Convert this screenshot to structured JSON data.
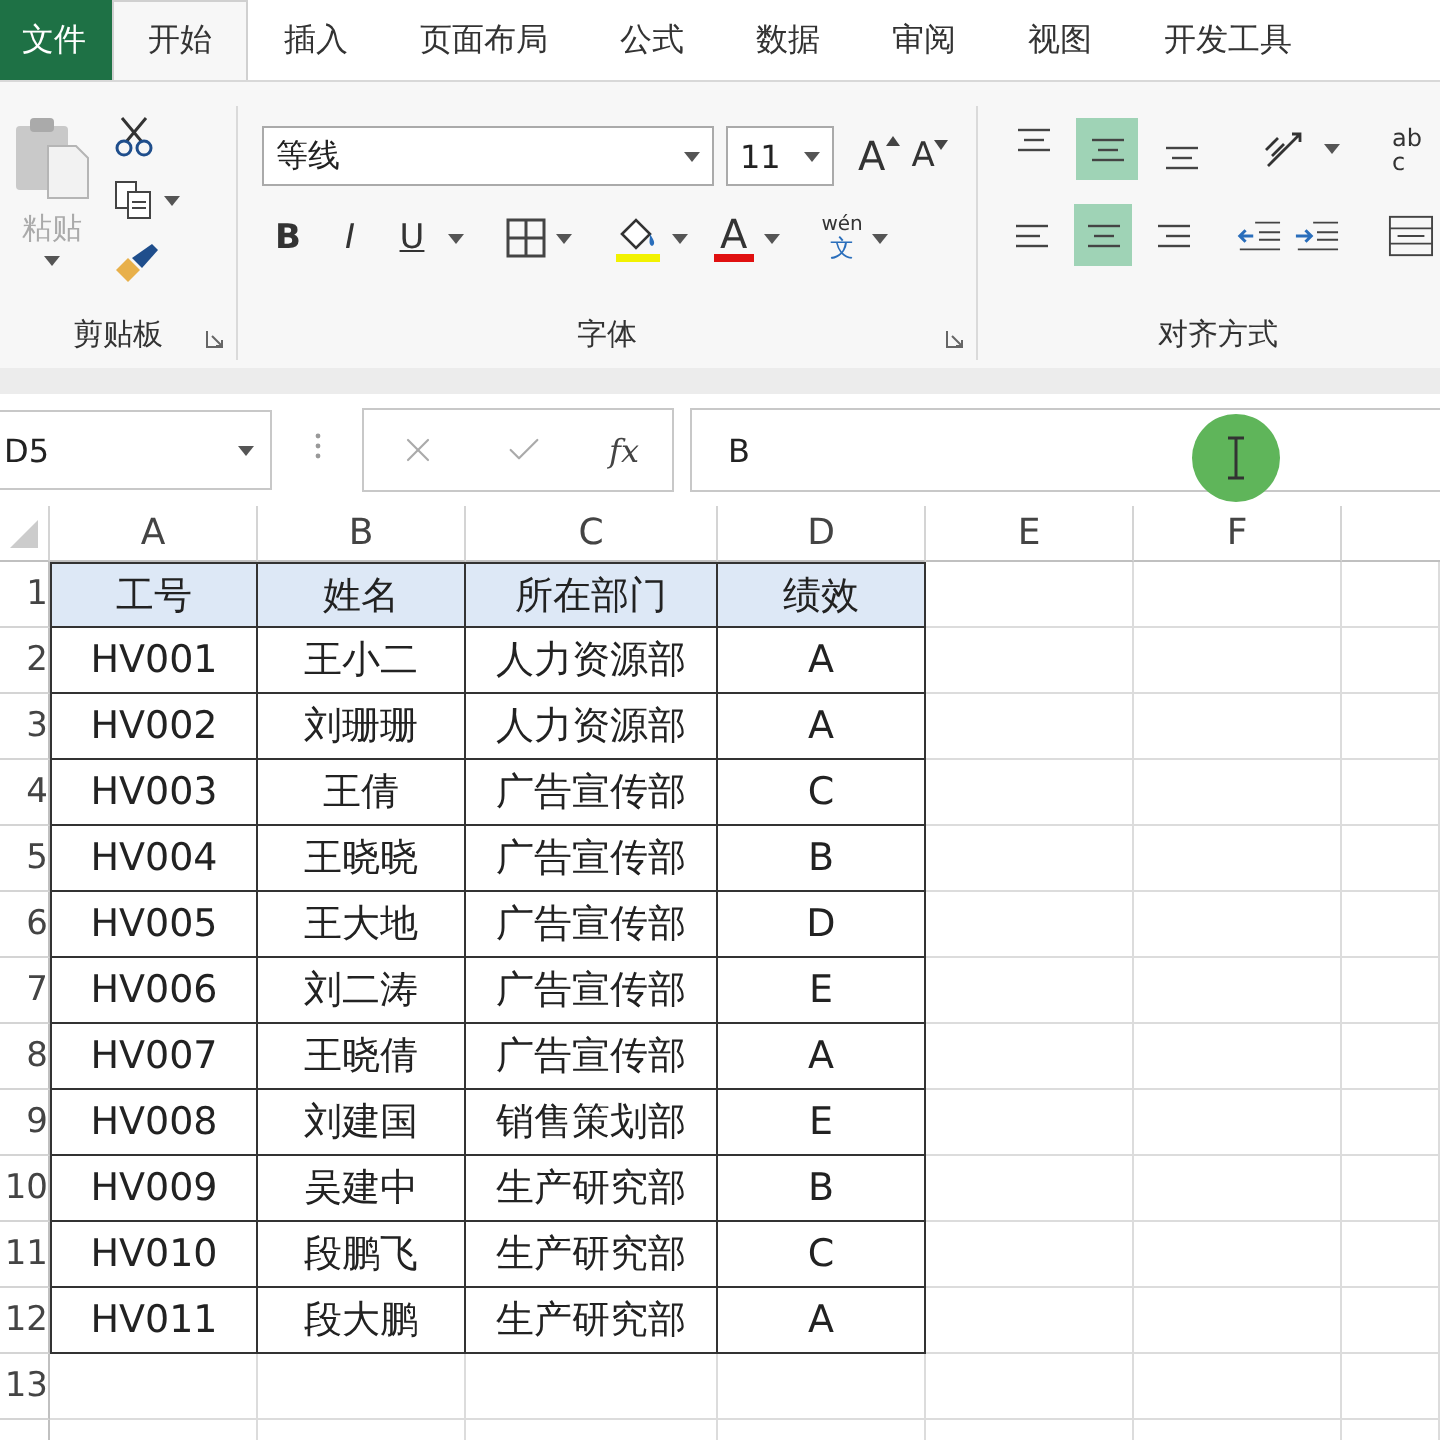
{
  "tabs": [
    {
      "label": "文件",
      "kind": "file",
      "selected": false
    },
    {
      "label": "开始",
      "kind": "tab",
      "selected": true
    },
    {
      "label": "插入",
      "kind": "tab",
      "selected": false
    },
    {
      "label": "页面布局",
      "kind": "tab",
      "selected": false
    },
    {
      "label": "公式",
      "kind": "tab",
      "selected": false
    },
    {
      "label": "数据",
      "kind": "tab",
      "selected": false
    },
    {
      "label": "审阅",
      "kind": "tab",
      "selected": false
    },
    {
      "label": "视图",
      "kind": "tab",
      "selected": false
    },
    {
      "label": "开发工具",
      "kind": "tab",
      "selected": false
    }
  ],
  "clipboard": {
    "paste_label": "粘贴",
    "group_label": "剪贴板"
  },
  "font": {
    "font_name": "等线",
    "font_size": "11",
    "grow": "A",
    "shrink": "A",
    "styles": [
      "B",
      "I",
      "U"
    ],
    "font_color": "A",
    "phonetic_top": "wén",
    "phonetic_bottom": "文",
    "group_label": "字体"
  },
  "alignment": {
    "vertical": [
      {
        "selected": false
      },
      {
        "selected": true
      },
      {
        "selected": false
      }
    ],
    "horizontal": [
      {
        "selected": false
      },
      {
        "selected": true
      },
      {
        "selected": false
      }
    ],
    "wrap_top": "ab",
    "wrap_bottom": "c",
    "group_label": "对齐方式"
  },
  "formula_bar": {
    "name_box": "D5",
    "fx": "fx",
    "value": "B"
  },
  "columns": [
    "A",
    "B",
    "C",
    "D",
    "E",
    "F"
  ],
  "rows": [
    {
      "number": "1",
      "kind": "header",
      "cells": [
        "工号",
        "姓名",
        "所在部门",
        "绩效"
      ]
    },
    {
      "number": "2",
      "kind": "data",
      "cells": [
        "HV001",
        "王小二",
        "人力资源部",
        "A"
      ]
    },
    {
      "number": "3",
      "kind": "data",
      "cells": [
        "HV002",
        "刘珊珊",
        "人力资源部",
        "A"
      ]
    },
    {
      "number": "4",
      "kind": "data",
      "cells": [
        "HV003",
        "王倩",
        "广告宣传部",
        "C"
      ]
    },
    {
      "number": "5",
      "kind": "data",
      "cells": [
        "HV004",
        "王晓晓",
        "广告宣传部",
        "B"
      ]
    },
    {
      "number": "6",
      "kind": "data",
      "cells": [
        "HV005",
        "王大地",
        "广告宣传部",
        "D"
      ]
    },
    {
      "number": "7",
      "kind": "data",
      "cells": [
        "HV006",
        "刘二涛",
        "广告宣传部",
        "E"
      ]
    },
    {
      "number": "8",
      "kind": "data",
      "cells": [
        "HV007",
        "王晓倩",
        "广告宣传部",
        "A"
      ]
    },
    {
      "number": "9",
      "kind": "data",
      "cells": [
        "HV008",
        "刘建国",
        "销售策划部",
        "E"
      ]
    },
    {
      "number": "10",
      "kind": "data",
      "cells": [
        "HV009",
        "吴建中",
        "生产研究部",
        "B"
      ]
    },
    {
      "number": "11",
      "kind": "data",
      "cells": [
        "HV010",
        "段鹏飞",
        "生产研究部",
        "C"
      ]
    },
    {
      "number": "12",
      "kind": "data",
      "cells": [
        "HV011",
        "段大鹏",
        "生产研究部",
        "A"
      ]
    },
    {
      "number": "13",
      "kind": "empty"
    }
  ]
}
